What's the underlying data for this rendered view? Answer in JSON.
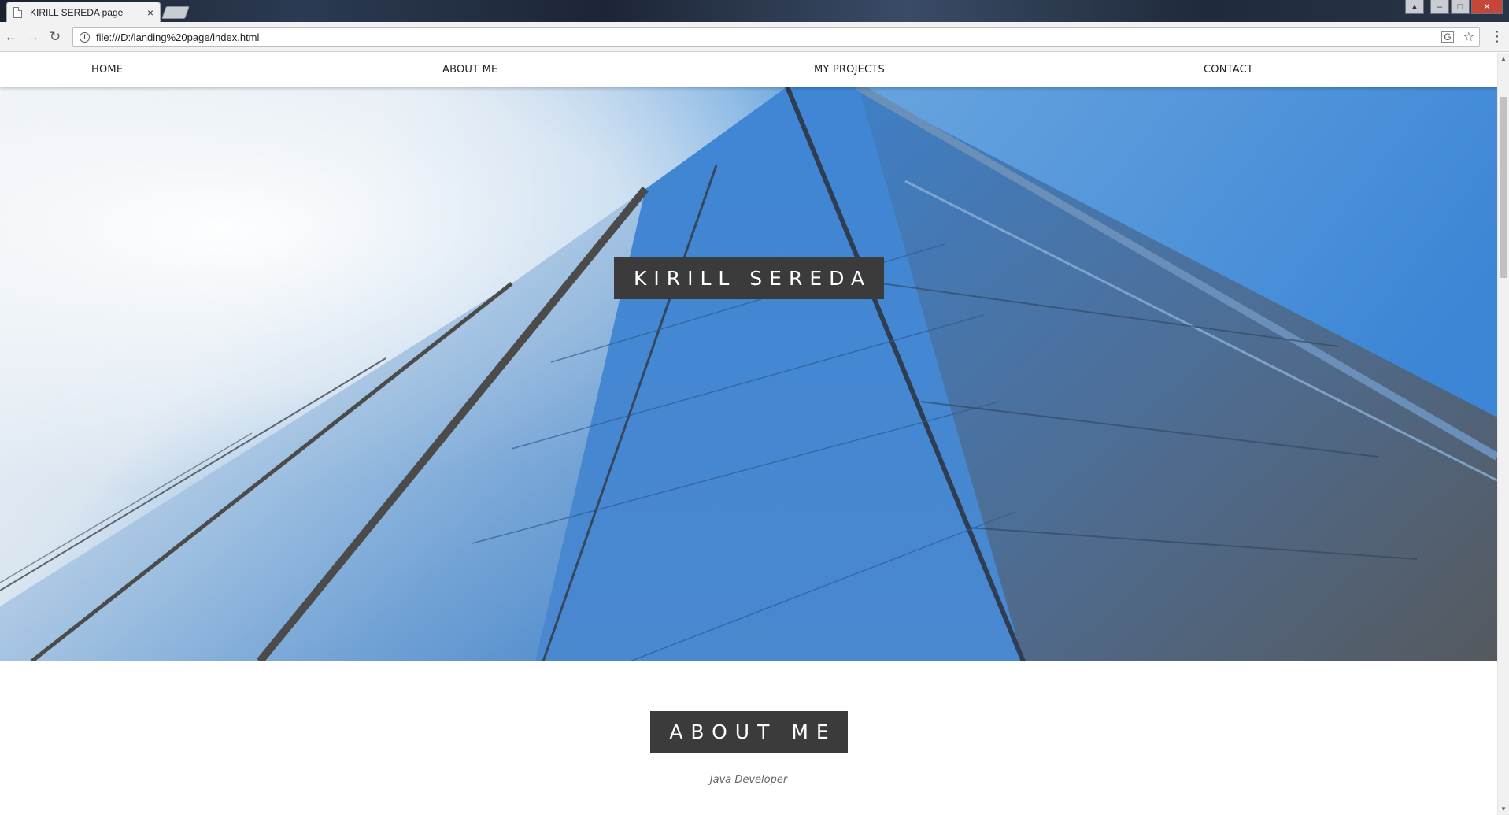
{
  "browser": {
    "tab_title": "KIRILL SEREDA page",
    "tab_close": "×",
    "address": "file:///D:/landing%20page/index.html",
    "info_icon": "i",
    "back_glyph": "←",
    "forward_glyph": "→",
    "reload_glyph": "↻",
    "star_glyph": "☆",
    "translate_glyph": "G",
    "menu_glyph": "⋮",
    "window_controls": {
      "minimize": "–",
      "maximize": "□",
      "close": "✕",
      "user": "▲"
    }
  },
  "nav": {
    "home": "HOME",
    "about": "ABOUT ME",
    "projects": "MY PROJECTS",
    "contact": "CONTACT"
  },
  "hero": {
    "title": "KIRILL SEREDA"
  },
  "about": {
    "title": "ABOUT ME",
    "subtitle": "Java Developer"
  },
  "colors": {
    "title_box_bg": "#3b3b3b",
    "sky": "#4a90d9",
    "nav_text": "#222222"
  }
}
